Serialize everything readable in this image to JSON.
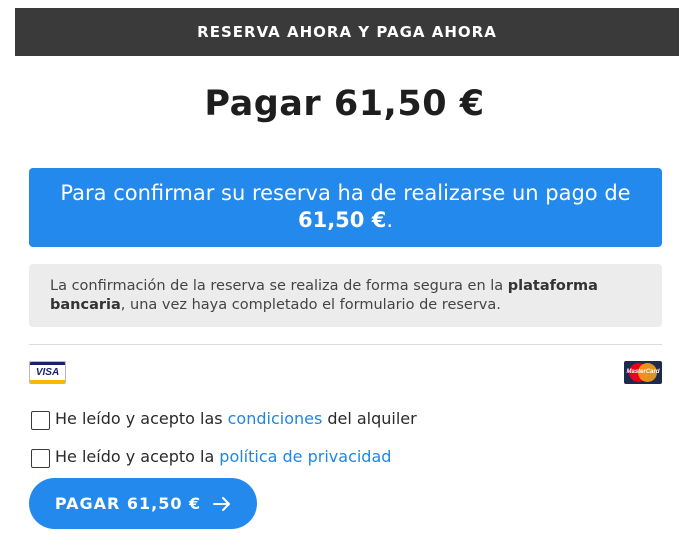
{
  "header": {
    "title": "RESERVA AHORA Y PAGA AHORA"
  },
  "amount": {
    "title": "Pagar 61,50 €"
  },
  "notice": {
    "text_before": "Para confirmar su reserva ha de realizarse un pago de ",
    "amount": "61,50 €",
    "text_after": "."
  },
  "security_note": {
    "text_before": "La confirmación de la reserva se realiza de forma segura en la ",
    "bold": "plataforma bancaria",
    "text_after": ", una vez haya completado el formulario de reserva."
  },
  "cards": [
    {
      "name": "VISA",
      "icon": "visa-card-icon"
    },
    {
      "name": "MasterCard",
      "icon": "mastercard-icon"
    }
  ],
  "checkboxes": {
    "terms": {
      "prefix": "He leído y acepto las",
      "link": "condiciones",
      "suffix": "del alquiler",
      "checked": false
    },
    "privacy": {
      "prefix": "He leído y acepto la",
      "link": "política de privacidad",
      "checked": false
    }
  },
  "pay_button": {
    "label": "PAGAR 61,50 €",
    "icon": "arrow-right-icon"
  },
  "colors": {
    "accent": "#2389ed",
    "header_bg": "#3a3a3a",
    "link": "#1f86e5",
    "note_bg": "#ececec"
  }
}
